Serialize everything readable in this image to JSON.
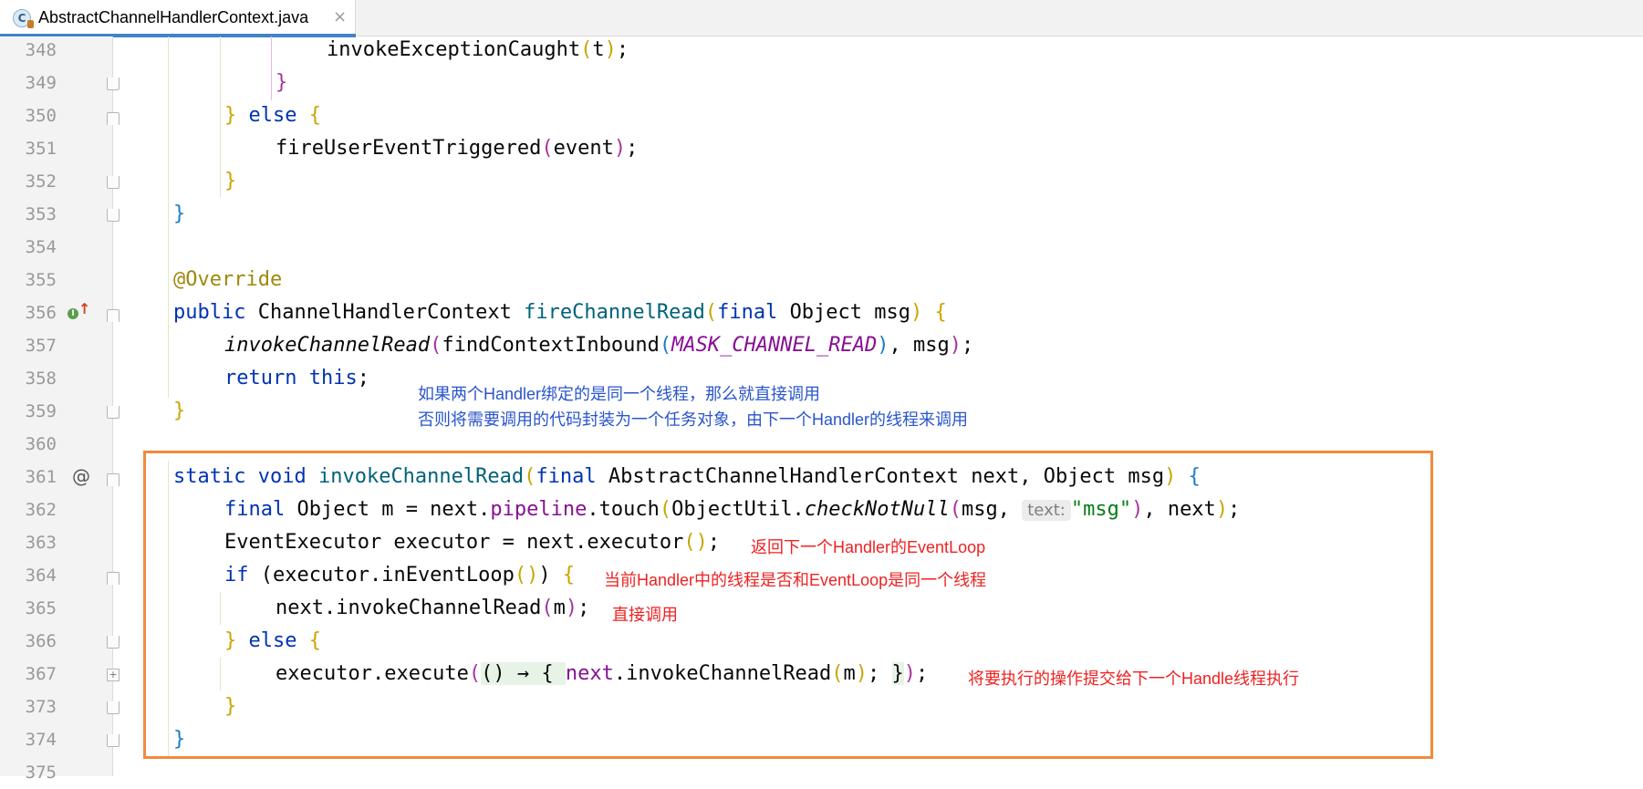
{
  "tab": {
    "title": "AbstractChannelHandlerContext.java",
    "icon_letter": "C",
    "close_glyph": "×",
    "icon": "class-icon"
  },
  "gutter": {
    "line_numbers": [
      "348",
      "349",
      "350",
      "351",
      "352",
      "353",
      "354",
      "355",
      "356",
      "357",
      "358",
      "359",
      "360",
      "361",
      "362",
      "363",
      "364",
      "365",
      "366",
      "367",
      "373",
      "374",
      "375"
    ],
    "at_symbol": "@",
    "impl_marker": "I",
    "override_arrow": "↑",
    "fold_plus": "+"
  },
  "code": {
    "l348": {
      "call": "invokeExceptionCaught",
      "open": "(",
      "arg": "t",
      "close": ")",
      "end": ";"
    },
    "l349": {
      "brace": "}"
    },
    "l350": {
      "brace": "}",
      "else_kw": "else",
      "open": "{"
    },
    "l351": {
      "call": "fireUserEventTriggered",
      "open": "(",
      "arg": "event",
      "close": ")",
      "end": ";"
    },
    "l352": {
      "brace": "}"
    },
    "l353": {
      "brace": "}"
    },
    "l355": {
      "annotation": "@Override"
    },
    "l356": {
      "public_kw": "public",
      "type": "ChannelHandlerContext",
      "method": "fireChannelRead",
      "open": "(",
      "final_kw": "final",
      "param_type": "Object",
      "param": "msg",
      "close": ")",
      "brace": "{"
    },
    "l357": {
      "call": "invokeChannelRead",
      "open": "(",
      "inner_call": "findContextInbound",
      "inner_open": "(",
      "constant": "MASK_CHANNEL_READ",
      "inner_close": ")",
      "rest": ", msg",
      "close": ")",
      "end": ";"
    },
    "l358": {
      "return_kw": "return",
      "this_kw": "this",
      "end": ";"
    },
    "l359": {
      "brace": "}"
    },
    "l361": {
      "static_kw": "static",
      "void_kw": "void",
      "method": "invokeChannelRead",
      "open": "(",
      "final_kw": "final",
      "params": "AbstractChannelHandlerContext next, Object msg",
      "close": ")",
      "brace": "{"
    },
    "l362": {
      "final_kw": "final",
      "decl": "Object m = next.",
      "field": "pipeline",
      "call": ".touch",
      "open": "(",
      "util": "ObjectUtil.",
      "static_call": "checkNotNull",
      "inner_open": "(",
      "arg1": "msg, ",
      "hint": "text:",
      "str": "\"msg\"",
      "inner_close": ")",
      "rest": ", next",
      "close": ")",
      "end": ";"
    },
    "l363": {
      "decl": "EventExecutor executor = next.executor",
      "open": "(",
      "close": ")",
      "end": ";"
    },
    "l364": {
      "if_kw": "if",
      "open": "(",
      "call": "executor.inEventLoop",
      "inner_open": "(",
      "inner_close": ")",
      "close": ")",
      "brace": "{"
    },
    "l365": {
      "call": "next.invokeChannelRead",
      "open": "(",
      "arg": "m",
      "close": ")",
      "end": ";"
    },
    "l366": {
      "brace": "}",
      "else_kw": "else",
      "open": "{"
    },
    "l367": {
      "call": "executor.execute",
      "open": "(",
      "lambda": "() → { ",
      "body_var": "next",
      "body_call": ".invokeChannelRead",
      "inner_open": "(",
      "arg": "m",
      "inner_close": ")",
      "semi": "; ",
      "lambda_close": "}",
      "close": ")",
      "end": ";"
    },
    "l373": {
      "brace": "}"
    },
    "l374": {
      "brace": "}"
    }
  },
  "annotations": {
    "blue_line1": "如果两个Handler绑定的是同一个线程，那么就直接调用",
    "blue_line2": "否则将需要调用的代码封装为一个任务对象，由下一个Handler的线程来调用",
    "red_363": "返回下一个Handler的EventLoop",
    "red_364": "当前Handler中的线程是否和EventLoop是同一个线程",
    "red_365": "直接调用",
    "red_367": "将要执行的操作提交给下一个Handle线程执行"
  },
  "colors": {
    "keyword": "#0033b3",
    "method_decl": "#00627a",
    "annotation": "#9e880d",
    "constant": "#871094",
    "string": "#067d17",
    "note_blue": "#2a55cc",
    "note_red": "#ee2222",
    "highlight_border": "#f08a3e",
    "tab_underline": "#4083c9"
  }
}
